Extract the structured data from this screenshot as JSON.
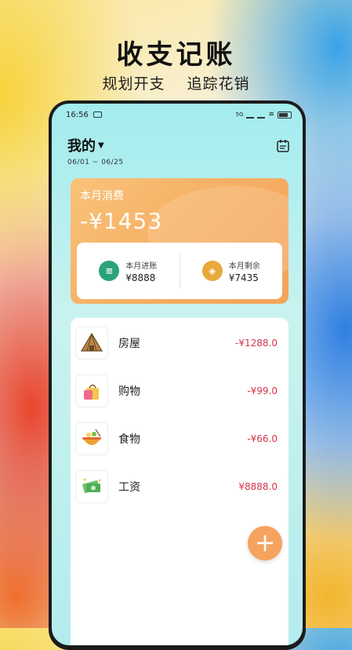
{
  "promo": {
    "headline": "收支记账",
    "sub_left": "规划开支",
    "sub_right": "追踪花销"
  },
  "status_bar": {
    "time": "16:56",
    "network": "5G"
  },
  "header": {
    "title": "我的",
    "date_range": "06/01 ~ 06/25"
  },
  "summary": {
    "label": "本月消费",
    "amount": "-¥1453",
    "income_label": "本月进账",
    "income_value": "¥8888",
    "remaining_label": "本月剩余",
    "remaining_value": "¥7435"
  },
  "transactions": [
    {
      "name": "房屋",
      "amount": "-¥1288.0",
      "icon": "house-icon"
    },
    {
      "name": "购物",
      "amount": "-¥99.0",
      "icon": "shopping-bag-icon"
    },
    {
      "name": "食物",
      "amount": "-¥66.0",
      "icon": "food-bowl-icon"
    },
    {
      "name": "工资",
      "amount": "¥8888.0",
      "icon": "money-icon"
    }
  ],
  "colors": {
    "expense": "#d2384c",
    "income": "#d2384c",
    "accent": "#f6a35f",
    "income_icon": "#2aa37a",
    "remaining_icon": "#e8a93a"
  },
  "fab": {
    "label": "+"
  }
}
